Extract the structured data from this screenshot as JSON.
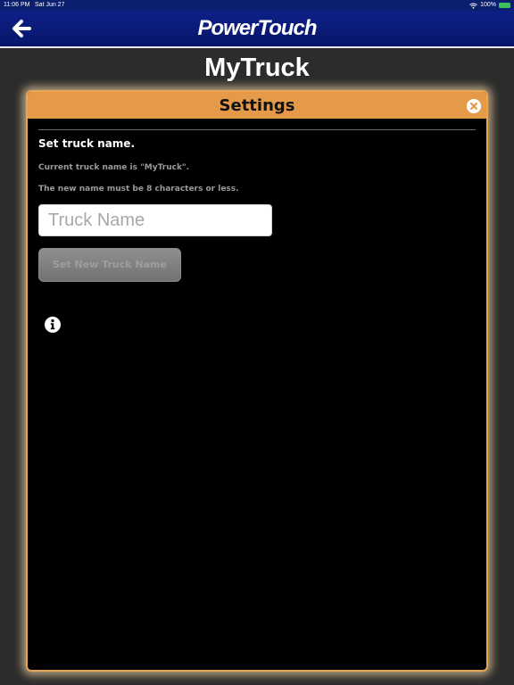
{
  "status_bar": {
    "time": "11:06 PM",
    "date": "Sat Jun 27",
    "battery": "100%",
    "icons": [
      "wifi-icon",
      "battery-icon"
    ]
  },
  "nav": {
    "brand": "PowerTouch",
    "back_icon": "arrow-left-icon"
  },
  "page": {
    "title": "MyTruck"
  },
  "dialog": {
    "title": "Settings",
    "close_icon": "close-circle-icon",
    "heading": "Set truck name.",
    "current_name_text": "Current truck name is \"MyTruck\".",
    "rule_text": "The new name must be 8 characters or less.",
    "input": {
      "value": "",
      "placeholder": "Truck Name"
    },
    "set_button_label": "Set New Truck Name",
    "info_icon": "info-icon"
  },
  "colors": {
    "nav_blue": "#0d1f86",
    "dialog_header": "#e59a4a",
    "dialog_border": "#e7a555",
    "background": "#2c2c2c"
  }
}
